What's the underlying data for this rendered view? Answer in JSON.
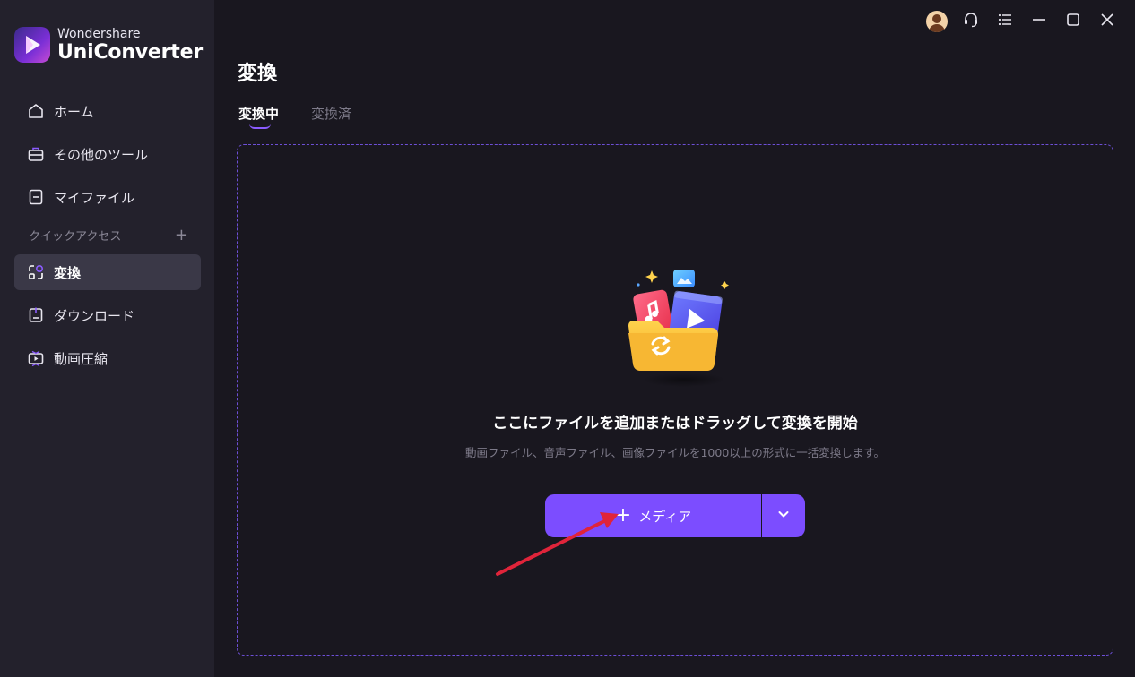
{
  "app": {
    "brand_sub": "Wondershare",
    "brand_main": "UniConverter"
  },
  "sidebar": {
    "items": [
      {
        "label": "ホーム",
        "icon": "home-icon"
      },
      {
        "label": "その他のツール",
        "icon": "toolbox-icon"
      },
      {
        "label": "マイファイル",
        "icon": "file-icon"
      }
    ],
    "quick_access_label": "クイックアクセス",
    "quick_items": [
      {
        "label": "変換",
        "icon": "convert-icon",
        "active": true
      },
      {
        "label": "ダウンロード",
        "icon": "download-icon"
      },
      {
        "label": "動画圧縮",
        "icon": "compress-icon"
      }
    ]
  },
  "titlebar": {
    "icons": [
      "avatar",
      "headset-icon",
      "menu-icon",
      "minimize-icon",
      "maximize-icon",
      "close-icon"
    ]
  },
  "main": {
    "title": "変換",
    "tabs": [
      {
        "label": "変換中",
        "active": true
      },
      {
        "label": "変換済",
        "active": false
      }
    ],
    "drop_title": "ここにファイルを追加またはドラッグして変換を開始",
    "drop_sub": "動画ファイル、音声ファイル、画像ファイルを1000以上の形式に一括変換します。",
    "add_button": "メディア"
  },
  "colors": {
    "accent": "#7c4dff",
    "sidebar_bg": "#23212c",
    "main_bg": "#19171f",
    "annotation_arrow": "#e0243a"
  }
}
